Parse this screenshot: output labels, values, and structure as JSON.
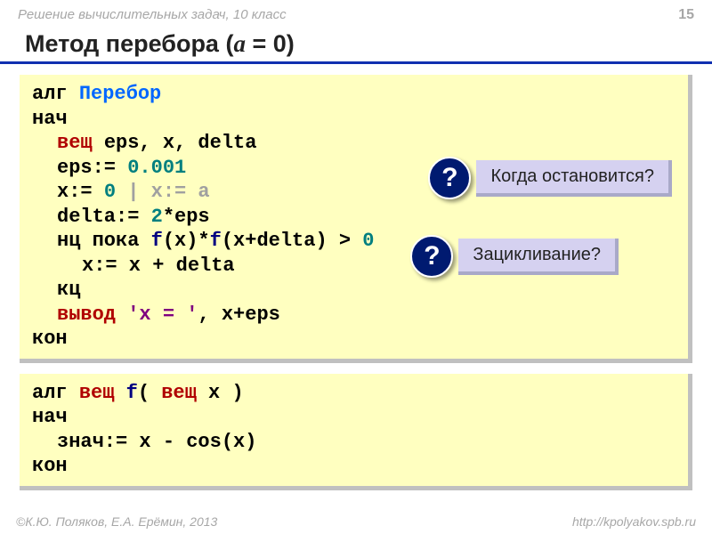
{
  "header": {
    "course": "Решение  вычислительных задач, 10 класс",
    "page": "15"
  },
  "title": {
    "prefix": "Метод перебора (",
    "var": "a",
    "suffix": " = 0)"
  },
  "code1": {
    "l1_kw": "алг ",
    "l1_name": "Перебор",
    "l2": "нач",
    "l3_type": "вещ ",
    "l3_rest": "eps, x, delta",
    "l4_a": "eps:= ",
    "l4_num": "0.001",
    "l5_a": "x:= ",
    "l5_num": "0",
    "l5_cmt": "   | x:= a",
    "l6_a": "delta:= ",
    "l6_num": "2",
    "l6_b": "*eps",
    "l7_a": "нц пока ",
    "l7_f1": "f",
    "l7_b": "(x)*",
    "l7_f2": "f",
    "l7_c": "(x+delta) > ",
    "l7_num": "0",
    "l8": "x:= x + delta",
    "l9": "кц",
    "l10_kw": "вывод ",
    "l10_str": "'x = '",
    "l10_rest": ", x+eps",
    "l11": "кон"
  },
  "callouts": {
    "q": "?",
    "c1": "Когда остановится?",
    "c2": "Зацикливание?"
  },
  "code2": {
    "l1_a": "алг ",
    "l1_type1": "вещ ",
    "l1_fn": "f",
    "l1_b": "( ",
    "l1_type2": "вещ ",
    "l1_c": "x )",
    "l2": "нач",
    "l3": "знач:= x - cos(x)",
    "l4": "кон"
  },
  "footer": {
    "left": "К.Ю. Поляков, Е.А. Ерёмин, 2013",
    "right": "http://kpolyakov.spb.ru"
  }
}
